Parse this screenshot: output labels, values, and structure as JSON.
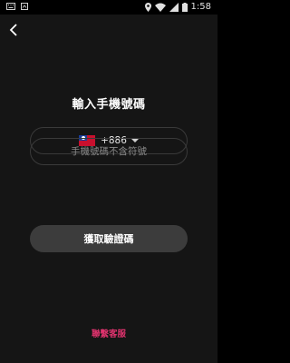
{
  "status_bar": {
    "time": "1:58",
    "icons": [
      "keyboard-icon",
      "notification-icon",
      "location-icon",
      "wifi-icon",
      "signal-icon",
      "battery-icon"
    ]
  },
  "nav": {
    "back_icon": "chevron-left-icon"
  },
  "page": {
    "title": "輸入手機號碼"
  },
  "country_selector": {
    "flag": "taiwan-flag-icon",
    "dial_code": "+886",
    "dropdown_icon": "caret-down-icon"
  },
  "phone_field": {
    "value": "",
    "placeholder": "手機號碼不含符號"
  },
  "submit": {
    "label": "獲取驗證碼"
  },
  "footer": {
    "contact_label": "聯繫客服"
  },
  "colors": {
    "background": "#151515",
    "field_border": "#3a3a3a",
    "button_bg": "#3c3c3c",
    "link": "#e0336e"
  }
}
